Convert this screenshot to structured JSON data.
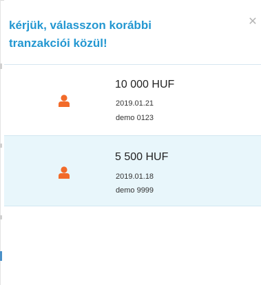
{
  "dialog": {
    "title_line1": "kérjük, válasszon korábbi",
    "title_line2": "tranzakciói közül!",
    "close_symbol": "✕"
  },
  "transactions": [
    {
      "amount": "10 000 HUF",
      "date": "2019.01.21",
      "reference": "demo 0123",
      "icon": "person-icon",
      "selected": false
    },
    {
      "amount": "5 500 HUF",
      "date": "2019.01.18",
      "reference": "demo 9999",
      "icon": "person-icon",
      "selected": true
    }
  ],
  "colors": {
    "title": "#2397d1",
    "icon": "#f26b2a",
    "selected_row": "#e8f6fb",
    "close": "#b5b5b5"
  }
}
